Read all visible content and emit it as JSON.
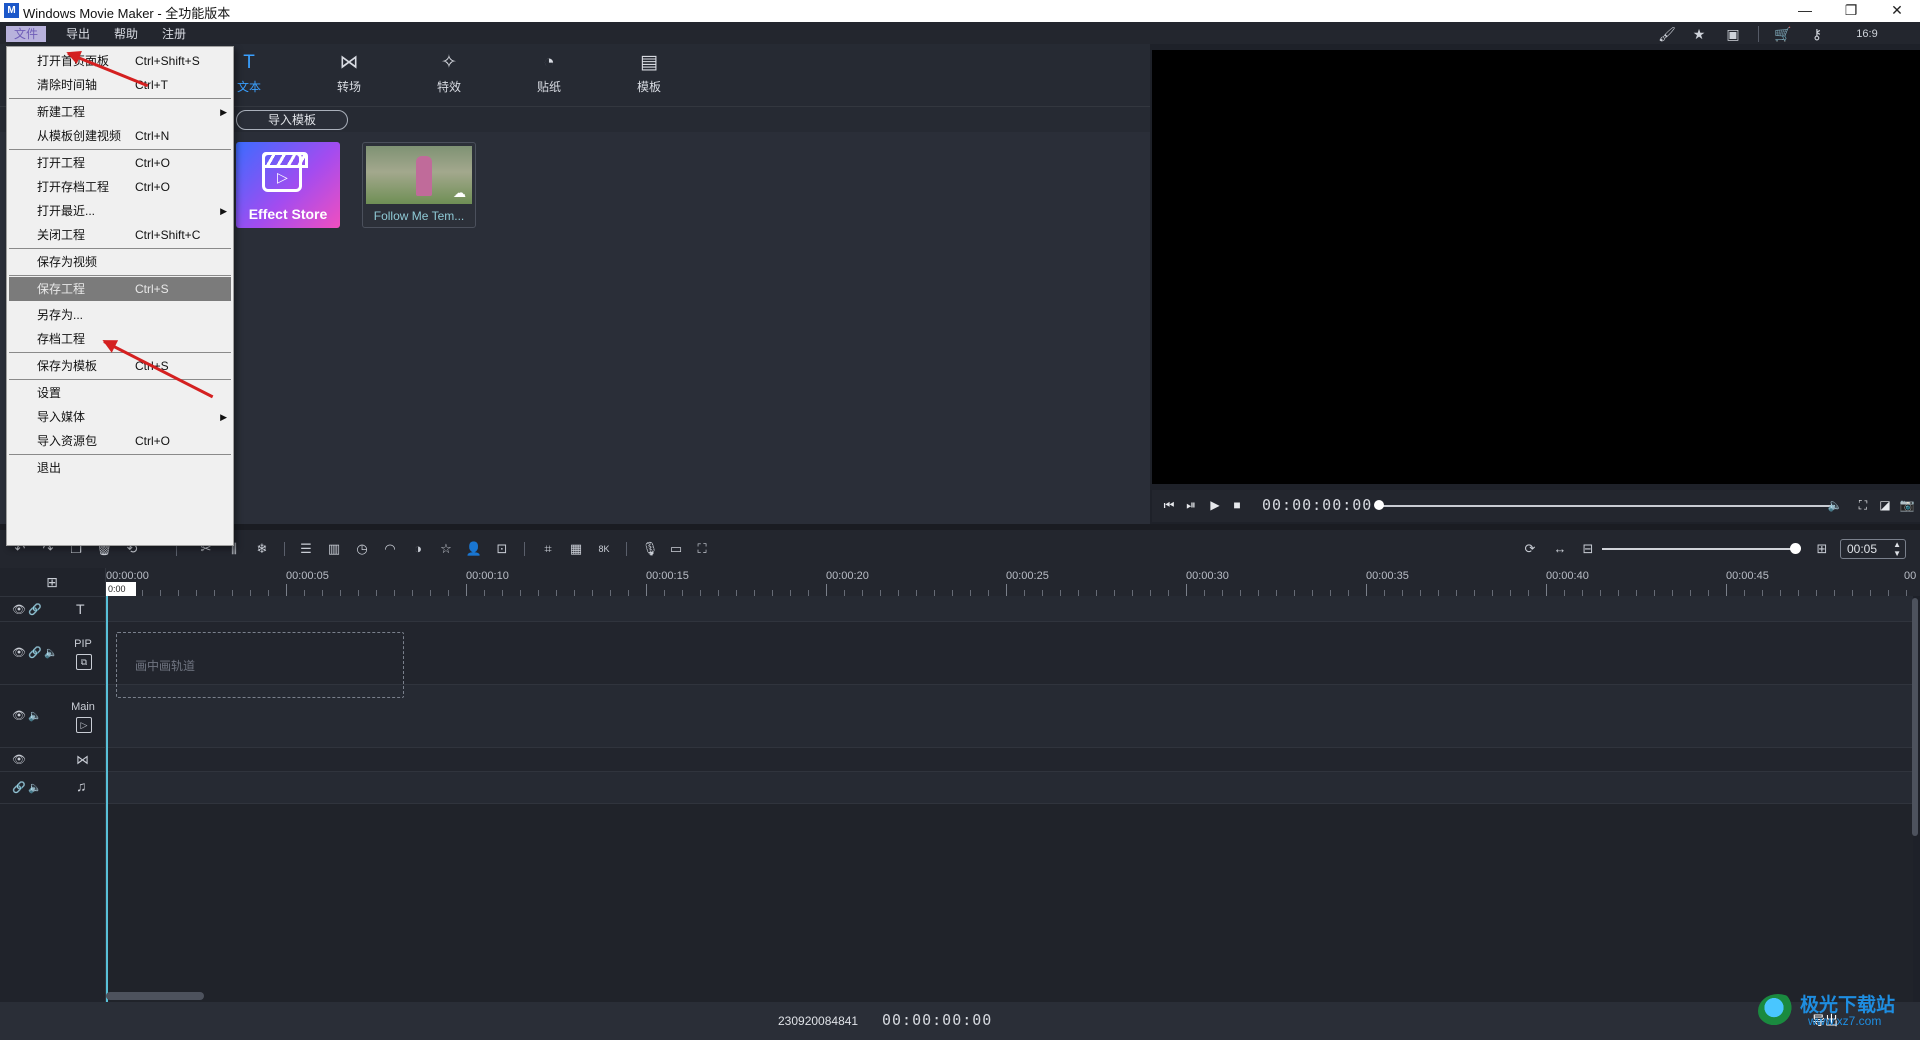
{
  "window": {
    "title": "Windows Movie Maker  - 全功能版本",
    "logo": "M",
    "controls": [
      "—",
      "❐",
      "✕"
    ]
  },
  "menubar": {
    "items": [
      "文件",
      "导出",
      "帮助",
      "注册"
    ],
    "right_icons": [
      "paint-roller-icon",
      "sparkle-star-icon",
      "save-icon",
      "cart-icon",
      "key-icon",
      "ratio-icon"
    ],
    "ratio_label": "16:9"
  },
  "file_menu": {
    "groups": [
      [
        {
          "label": "打开首页面板",
          "shortcut": "Ctrl+Shift+S"
        },
        {
          "label": "清除时间轴",
          "shortcut": "Ctrl+T"
        }
      ],
      [
        {
          "label": "新建工程",
          "shortcut": "",
          "submenu": "▶"
        },
        {
          "label": "从模板创建视频",
          "shortcut": "Ctrl+N"
        }
      ],
      [
        {
          "label": "打开工程",
          "shortcut": "Ctrl+O"
        },
        {
          "label": "打开存档工程",
          "shortcut": "Ctrl+O"
        },
        {
          "label": "打开最近...",
          "shortcut": "",
          "submenu": "▶"
        },
        {
          "label": "关闭工程",
          "shortcut": "Ctrl+Shift+C"
        }
      ],
      [
        {
          "label": "保存为视频",
          "shortcut": ""
        },
        {
          "label": "保存工程",
          "shortcut": "Ctrl+S",
          "highlighted": true
        },
        {
          "label": "另存为...",
          "shortcut": ""
        },
        {
          "label": "存档工程",
          "shortcut": ""
        }
      ],
      [
        {
          "label": "保存为模板",
          "shortcut": "Ctrl+S"
        }
      ],
      [
        {
          "label": "设置",
          "shortcut": ""
        },
        {
          "label": "导入媒体",
          "shortcut": "",
          "submenu": "▶"
        },
        {
          "label": "导入资源包",
          "shortcut": "Ctrl+O"
        }
      ],
      [
        {
          "label": "退出",
          "shortcut": ""
        }
      ]
    ]
  },
  "media_tabs": [
    {
      "label": "文本",
      "icon": "T",
      "active": true
    },
    {
      "label": "转场",
      "icon": "⋈"
    },
    {
      "label": "特效",
      "icon": "✧"
    },
    {
      "label": "贴纸",
      "icon": "◔"
    },
    {
      "label": "模板",
      "icon": "▤"
    }
  ],
  "media": {
    "import_template": "导入模板",
    "effect_store": "Effect Store",
    "template_card": "Follow Me Tem..."
  },
  "preview": {
    "timecode": "00:00:00:00"
  },
  "timeline": {
    "zoom_value": "00:05",
    "ruler": [
      "00:00:00",
      "00:00:05",
      "00:00:10",
      "00:00:15",
      "00:00:20",
      "00:00:25",
      "00:00:30",
      "00:00:35",
      "00:00:40",
      "00:00:45",
      "00"
    ],
    "playhead_label": "0:00",
    "tracks": {
      "pip": "PIP",
      "main": "Main",
      "pip_placeholder": "画中画轨道"
    }
  },
  "status": {
    "id": "230920084841",
    "timecode": "00:00:00:00",
    "export": "导出"
  },
  "watermark": {
    "main": "极光下载站",
    "sub": "www.xz7.com"
  },
  "colors": {
    "accent": "#3aa0ff",
    "menu_active": "#b8b2dc",
    "annotation": "#d42020",
    "playhead": "#58c0d8"
  }
}
